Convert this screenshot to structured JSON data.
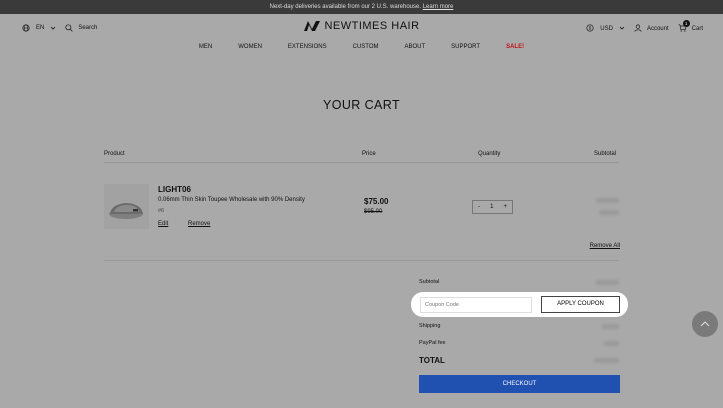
{
  "announcement": {
    "text": "Next-day deliveries available from our 2 U.S. warehouse.",
    "link": "Learn more"
  },
  "header": {
    "language": "EN",
    "search_label": "Search",
    "brand": "NEWTIMES HAIR",
    "currency": "USD",
    "account_label": "Account",
    "cart_label": "Cart",
    "cart_count": "1"
  },
  "nav": [
    "MEN",
    "WOMEN",
    "EXTENSIONS",
    "CUSTOM",
    "ABOUT",
    "SUPPORT",
    "SALE!"
  ],
  "page_title": "YOUR CART",
  "table_headers": {
    "product": "Product",
    "price": "Price",
    "quantity": "Quantity",
    "subtotal": "Subtotal"
  },
  "item": {
    "name": "LIGHT06",
    "description": "0.06mm Thin Skin Toupee Wholesale with 90% Density",
    "variant": "#6",
    "edit_label": "Edit",
    "remove_label": "Remove",
    "price": "$75.00",
    "original_price": "$95.00",
    "quantity": "1",
    "minus": "-",
    "plus": "+"
  },
  "remove_all": "Remove All",
  "summary": {
    "subtotal_label": "Subtotal",
    "coupon_placeholder": "Coupon Code",
    "apply_coupon": "APPLY COUPON",
    "shipping_label": "Shipping",
    "paypal_fee_label": "PayPal fee",
    "total_label": "TOTAL",
    "checkout_label": "CHECKOUT"
  },
  "colors": {
    "announcement_bg": "#3a3a3a",
    "sale": "#c0121b",
    "checkout": "#2050b0"
  }
}
